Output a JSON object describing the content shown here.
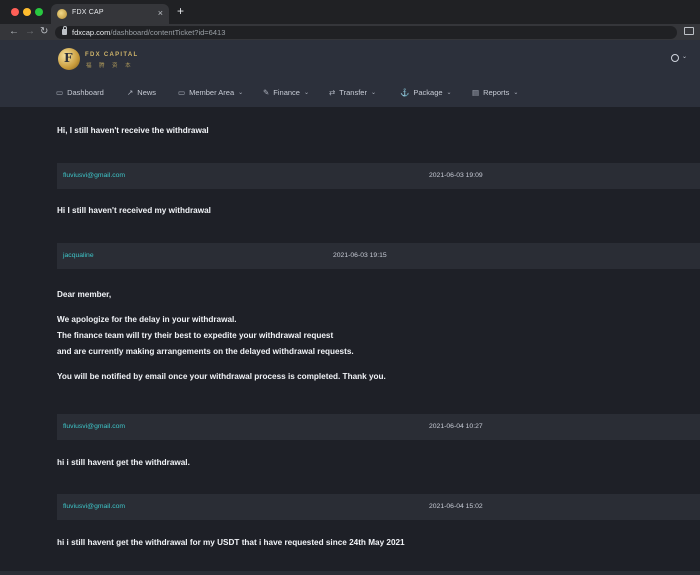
{
  "browser": {
    "tab_title": "FDX CAP",
    "tab_close": "×",
    "new_tab": "+",
    "url_host": "fdxcap.com",
    "url_path": "/dashboard/contentTicket?id=6413"
  },
  "site": {
    "brand": "FDX CAPITAL",
    "brand_sub": "福 腾 资 本",
    "logo_mark": "F",
    "menu": [
      {
        "label": "Dashboard",
        "icon": "monitor-icon"
      },
      {
        "label": "News",
        "icon": "trend-icon"
      },
      {
        "label": "Member Area",
        "icon": "folder-icon"
      },
      {
        "label": "Finance",
        "icon": "edit-icon"
      },
      {
        "label": "Transfer",
        "icon": "shuffle-icon"
      },
      {
        "label": "Package",
        "icon": "anchor-icon"
      },
      {
        "label": "Reports",
        "icon": "report-icon"
      }
    ]
  },
  "thread": {
    "first_message": "Hi, I still haven't receive the withdrawal",
    "entries": [
      {
        "sender": "fluviusvi@gmail.com",
        "time": "2021-06-03 19:09",
        "message": "Hi I still haven't received my withdrawal"
      },
      {
        "sender": "jacqualine",
        "time": "2021-06-03 19:15",
        "message_lines": [
          "Dear member,",
          "We apologize for the delay in your withdrawal.",
          "The finance team will try their best to expedite your withdrawal request",
          "and are currently making arrangements on the delayed withdrawal requests.",
          "You will be notified by email once your withdrawal process is completed. Thank you."
        ]
      },
      {
        "sender": "fluviusvi@gmail.com",
        "time": "2021-06-04 10:27",
        "message": "hi i still havent get the withdrawal."
      },
      {
        "sender": "fluviusvi@gmail.com",
        "time": "2021-06-04 15:02",
        "message": "hi i still havent get the withdrawal for my USDT that i have requested since 24th May 2021"
      }
    ]
  },
  "colors": {
    "sender": "#3ec6c9",
    "header_bg": "#2c303b",
    "page_bg": "#1e2027",
    "bar_bg": "#2a2d35"
  }
}
